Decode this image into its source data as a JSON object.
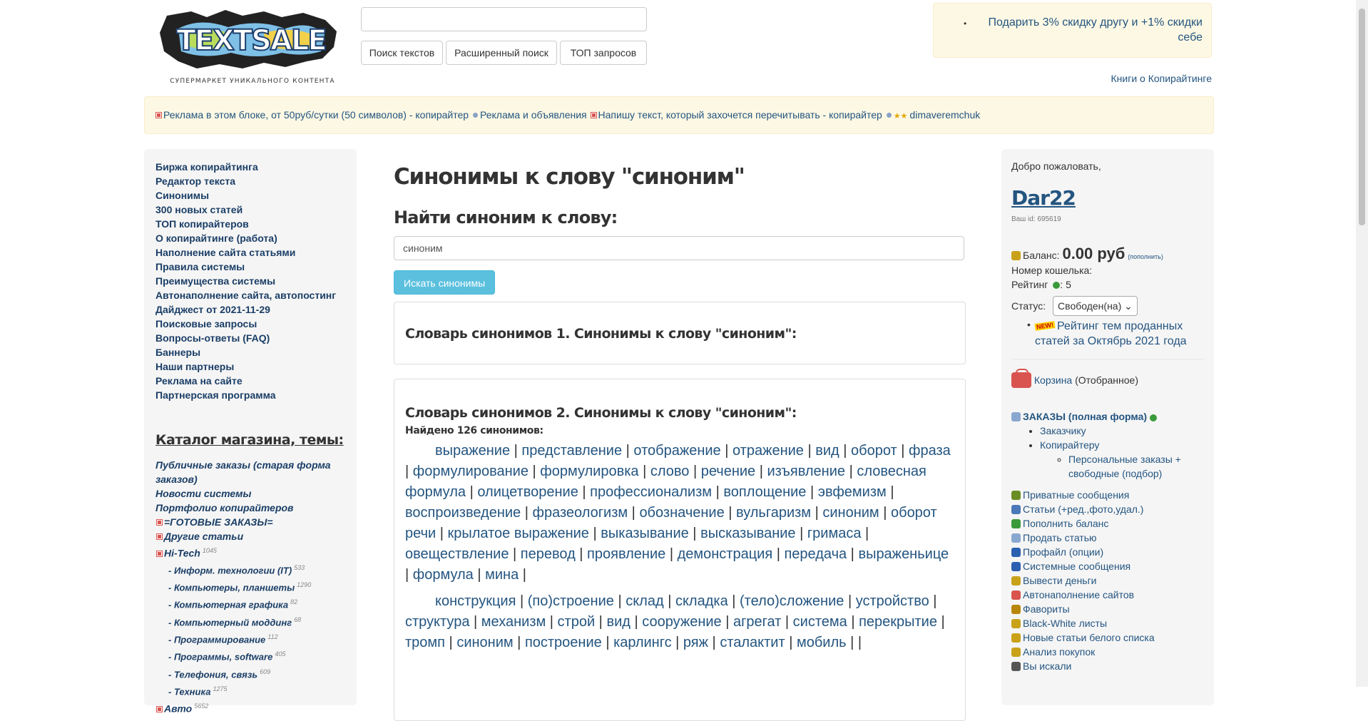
{
  "header": {
    "logo_text": "TEXTSALE",
    "logo_sub": "СУПЕРМАРКЕТ УНИКАЛЬНОГО КОНТЕНТА",
    "search_value": "",
    "buttons": [
      "Поиск текстов",
      "Расширенный поиск",
      "ТОП запросов"
    ],
    "promo": "Подарить 3% скидку другу и +1% скидки себе",
    "books_link": "Книги о Копирайтинге"
  },
  "adbar": {
    "items": [
      {
        "marker": "red",
        "text": "Реклама в этом блоке, от 50руб/сутки (50 символов) - копирайтер"
      },
      {
        "marker": "blue",
        "text": "Реклама и объявления"
      },
      {
        "marker": "red",
        "text": "Напишу текст, который захочется перечитывать - копирайтер"
      },
      {
        "marker": "blue",
        "text": "dimaveremchuk"
      }
    ]
  },
  "left": {
    "nav": [
      "Биржа копирайтинга",
      "Редактор текста",
      "Синонимы",
      "300 новых статей",
      "ТОП копирайтеров",
      "О копирайтинге (работа)",
      "Наполнение сайта статьями",
      "Правила системы",
      "Преимущества системы",
      "Автонаполнение сайта, автопостинг",
      "Дайджест от 2021-11-29",
      "Поисковые запросы",
      "Вопросы-ответы (FAQ)",
      "Баннеры",
      "Наши партнеры",
      "Реклама на сайте",
      "Партнерская программа"
    ],
    "catalog_title": "Каталог магазина, темы:",
    "catalog_top": [
      "Публичные заказы (старая форма заказов)",
      "Новости системы",
      "Портфолио копирайтеров"
    ],
    "catalog_marked": [
      "=ГОТОВЫЕ ЗАКАЗЫ=",
      "Другие статьи"
    ],
    "hitech": {
      "label": "Hi-Tech",
      "count": "1045"
    },
    "sub": [
      {
        "label": "- Информ. технологии (IT)",
        "count": "533"
      },
      {
        "label": "- Компьютеры, планшеты",
        "count": "1290"
      },
      {
        "label": "- Компьютерная графика",
        "count": "82"
      },
      {
        "label": "- Компьютерный моддинг",
        "count": "68"
      },
      {
        "label": "- Программирование",
        "count": "112"
      },
      {
        "label": "- Программы, software",
        "count": "405"
      },
      {
        "label": "- Телефония, связь",
        "count": "609"
      },
      {
        "label": "- Техника",
        "count": "1275"
      }
    ],
    "avto": {
      "label": "Авто",
      "count": "5652"
    }
  },
  "main": {
    "title": "Синонимы к слову \"синоним\"",
    "find_label": "Найти синоним к слову:",
    "input_value": "синоним",
    "search_button": "Искать синонимы",
    "dict1_title": "Словарь синонимов 1. Синонимы к слову \"синоним\":",
    "dict2_title": "Словарь синонимов 2. Синонимы к слову \"синоним\":",
    "found": "Найдено 126 синонимов:",
    "group1": [
      "выражение",
      "представление",
      "отображение",
      "отражение",
      "вид",
      "оборот",
      "фраза",
      "формулирование",
      "формулировка",
      "слово",
      "речение",
      "изъявление",
      "словесная формула",
      "олицетворение",
      "профессионализм",
      "воплощение",
      "эвфемизм",
      "воспроизведение",
      "фразеологизм",
      "обозначение",
      "вульгаризм",
      "синоним",
      "оборот речи",
      "крылатое выражение",
      "выказывание",
      "высказывание",
      "гримаса",
      "овеществление",
      "перевод",
      "проявление",
      "демонстрация",
      "передача",
      "выраженьице",
      "формула",
      "мина"
    ],
    "group2": [
      "конструкция",
      "(по)строение",
      "склад",
      "складка",
      "(тело)сложение",
      "устройство",
      "структура",
      "механизм",
      "строй",
      "вид",
      "сооружение",
      "агрегат",
      "система",
      "перекрытие",
      "тромп",
      "синоним",
      "построение",
      "карлингс",
      "ряж",
      "сталактит",
      "мобиль",
      ""
    ]
  },
  "right": {
    "welcome": "Добро пожаловать,",
    "username": "Dar22",
    "user_id": "Ваш id: 695619",
    "balance_label": "Баланс:",
    "balance_value": "0.00 руб",
    "balance_link": "(пополнить)",
    "wallet": "Номер кошелька:",
    "rating_label": "Рейтинг",
    "rating_value": ": 5",
    "status_label": "Статус:",
    "status_value": "Свободен(на)",
    "new_badge": "NEW!",
    "rating_link": "Рейтинг тем проданных статей за Октябрь 2021 года",
    "basket_link": "Корзина",
    "basket_note": "(Отобранное)",
    "orders_title": "ЗАКАЗЫ (полная форма)",
    "orders_sub": [
      "Заказчику",
      "Копирайтеру"
    ],
    "orders_sub2": "Персональные заказы + свободные (подбор)",
    "menu": [
      {
        "label": "Приватные сообщения",
        "color": "#6b8e23"
      },
      {
        "label": "Статьи (+ред.,фото,удал.)",
        "color": "#4a78b8"
      },
      {
        "label": "Пополнить баланс",
        "color": "#3a9a3a"
      },
      {
        "label": "Продать статью",
        "color": "#8aa7cf"
      },
      {
        "label": "Профайл (опции)",
        "color": "#2b5fb0"
      },
      {
        "label": "Системные сообщения",
        "color": "#2b5fb0"
      },
      {
        "label": "Вывести деньги",
        "color": "#c9a21a"
      },
      {
        "label": "Автонаполнение сайтов",
        "color": "#d9534f"
      },
      {
        "label": "Фавориты",
        "color": "#b8860b"
      },
      {
        "label": "Black-White листы",
        "color": "#c9a21a"
      },
      {
        "label": "Новые статьи белого списка",
        "color": "#c9a21a"
      },
      {
        "label": "Анализ покупок",
        "color": "#c9a21a"
      },
      {
        "label": "Вы искали",
        "color": "#555555"
      }
    ]
  }
}
